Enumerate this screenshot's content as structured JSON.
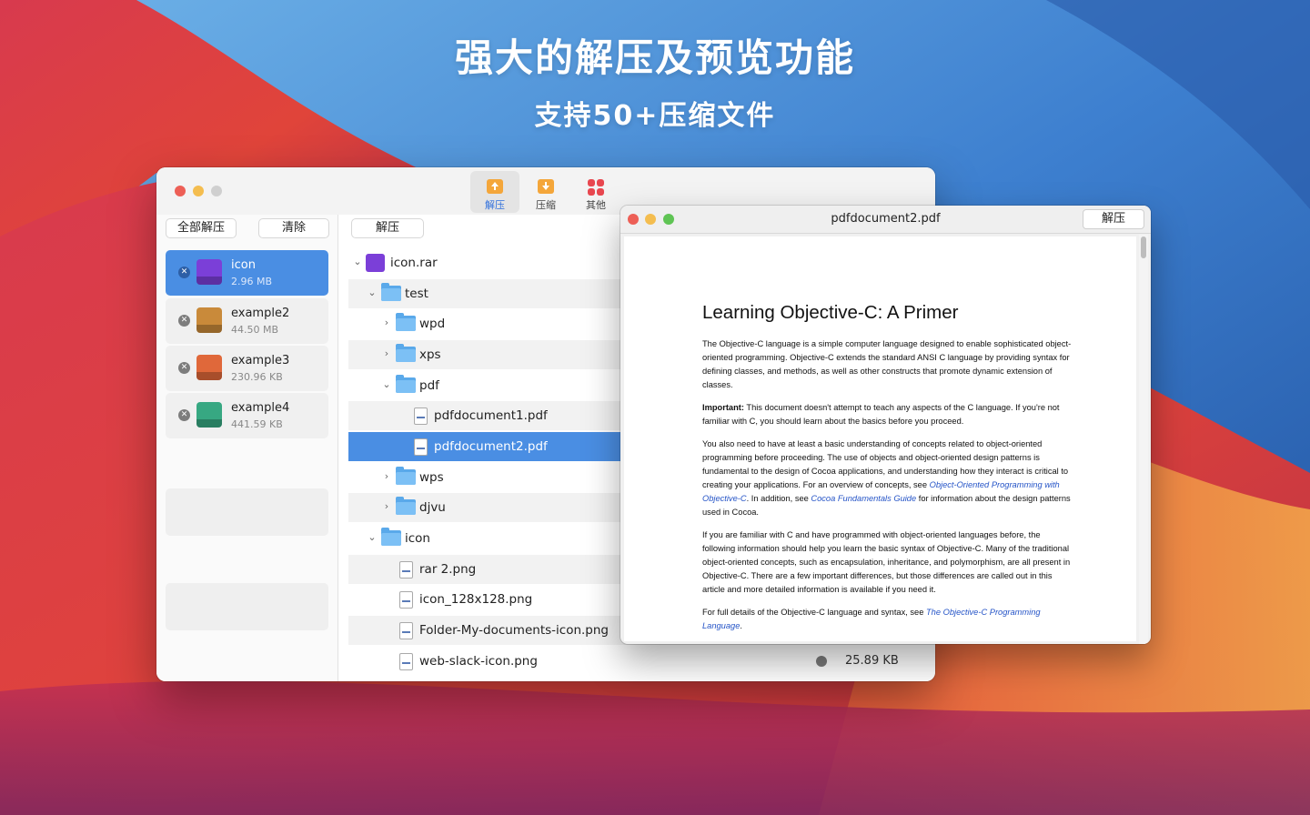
{
  "promo": {
    "headline": "强大的解压及预览功能",
    "subheadline": "支持50+压缩文件"
  },
  "toolbar": {
    "extract": "解压",
    "compress": "压缩",
    "other": "其他"
  },
  "left_pane": {
    "extract_all": "全部解压",
    "clear": "清除",
    "archives": [
      {
        "name": "icon",
        "size": "2.96 MB",
        "badge": "RAR",
        "color": "#7b3fd8"
      },
      {
        "name": "example2",
        "size": "44.50 MB",
        "badge": "ARCHIVE",
        "color": "#c98a3a"
      },
      {
        "name": "example3",
        "size": "230.96 KB",
        "badge": "7Z",
        "color": "#e0683a"
      },
      {
        "name": "example4",
        "size": "441.59 KB",
        "badge": "BZ2",
        "color": "#37a882"
      }
    ]
  },
  "mid_pane": {
    "extract_button": "解压",
    "tree": [
      {
        "label": "icon.rar"
      },
      {
        "label": "test"
      },
      {
        "label": "wpd"
      },
      {
        "label": "xps"
      },
      {
        "label": "pdf"
      },
      {
        "label": "pdfdocument1.pdf"
      },
      {
        "label": "pdfdocument2.pdf"
      },
      {
        "label": "wps"
      },
      {
        "label": "djvu"
      },
      {
        "label": "icon"
      },
      {
        "label": "rar 2.png"
      },
      {
        "label": "icon_128x128.png"
      },
      {
        "label": "Folder-My-documents-icon.png"
      },
      {
        "label": "web-slack-icon.png",
        "size": "25.89 KB"
      }
    ]
  },
  "pdf_preview": {
    "title": "pdfdocument2.pdf",
    "extract_button": "解压",
    "heading": "Learning Objective-C: A Primer",
    "p1": "The Objective-C language is a simple computer language designed to enable sophisticated object-oriented programming. Objective-C extends the standard ANSI C language by providing syntax for defining classes, and methods, as well as other constructs that promote dynamic extension of classes.",
    "p2_label": "Important:",
    "p2": " This document doesn't attempt to teach any aspects of the C language. If you're not familiar with C, you should learn about the basics before you proceed.",
    "p3a": "You also need to have at least a basic understanding of concepts related to object-oriented programming before proceeding. The use of objects and object-oriented design patterns is fundamental to the design of Cocoa applications, and understanding how they interact is critical to creating your applications. For an overview of concepts, see ",
    "p3_link1": "Object-Oriented Programming with Objective-C",
    "p3b": ". In addition, see ",
    "p3_link2": "Cocoa Fundamentals Guide",
    "p3c": " for information about the design patterns used in Cocoa.",
    "p4": "If you are familiar with C and have programmed with object-oriented languages before, the following information should help you learn the basic syntax of Objective-C. Many of the traditional object-oriented concepts, such as encapsulation, inheritance, and polymorphism, are all present in Objective-C. There are a few important differences, but those differences are called out in this article and more detailed information is available if you need it.",
    "p5a": "For full details of the Objective-C language and syntax, see ",
    "p5_link": "The Objective-C Programming Language",
    "p5b": "."
  },
  "colors": {
    "accent": "#4a8ee3",
    "close": "#ed5f56",
    "minimize": "#f4bd4f",
    "zoom": "#5fc454"
  }
}
